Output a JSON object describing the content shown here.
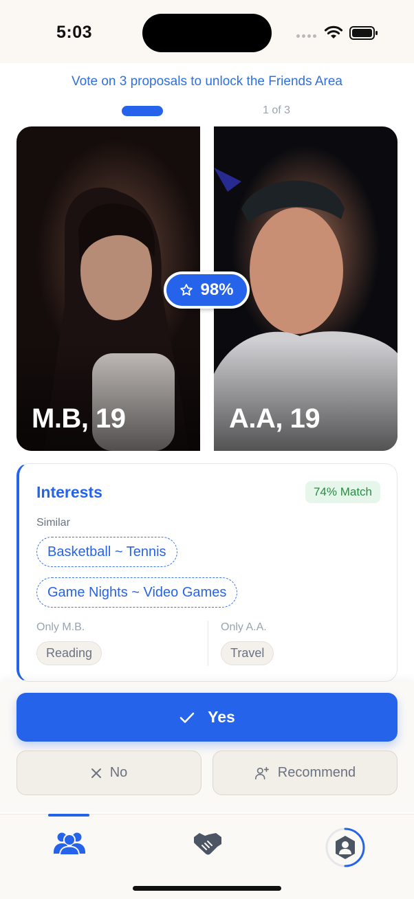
{
  "status_bar": {
    "time": "5:03"
  },
  "header": {
    "unlock_message": "Vote on 3 proposals to unlock the Friends Area",
    "progress_label": "1 of 3",
    "progress_current": 1,
    "progress_total": 3
  },
  "profiles": [
    {
      "name_age": "M.B, 19"
    },
    {
      "name_age": "A.A, 19"
    }
  ],
  "compatibility": {
    "label": "98%",
    "icon": "star-icon"
  },
  "interests": {
    "title": "Interests",
    "match_label": "74% Match",
    "similar_label": "Similar",
    "similar": [
      "Basketball ~ Tennis",
      "Game Nights ~ Video Games"
    ],
    "only_left_label": "Only M.B.",
    "only_left": [
      "Reading"
    ],
    "only_right_label": "Only A.A.",
    "only_right": [
      "Travel"
    ]
  },
  "actions": {
    "yes_label": "Yes",
    "no_label": "No",
    "recommend_label": "Recommend"
  },
  "tabs": [
    {
      "name": "friends",
      "icon": "people-icon",
      "active": true
    },
    {
      "name": "handshake",
      "icon": "handshake-icon",
      "active": false
    },
    {
      "name": "profile",
      "icon": "profile-shield-icon",
      "active": false
    }
  ],
  "colors": {
    "accent": "#2563eb",
    "match_green": "#2d8a46",
    "surface": "#fbf9f6"
  }
}
